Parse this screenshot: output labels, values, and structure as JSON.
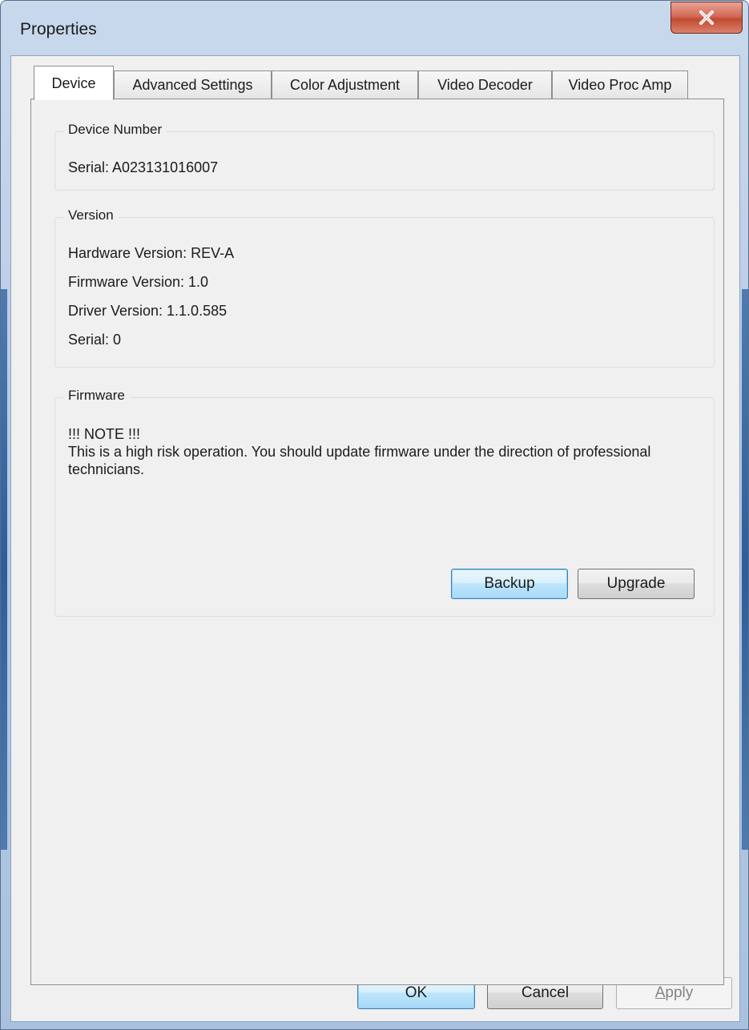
{
  "window": {
    "title": "Properties",
    "close_glyph": "X"
  },
  "tabs": [
    {
      "label": "Device",
      "active": true
    },
    {
      "label": "Advanced Settings",
      "active": false
    },
    {
      "label": "Color Adjustment",
      "active": false
    },
    {
      "label": "Video Decoder",
      "active": false
    },
    {
      "label": "Video Proc Amp",
      "active": false
    }
  ],
  "device_number": {
    "title": "Device Number",
    "serial": "Serial: A023131016007"
  },
  "version": {
    "title": "Version",
    "hardware": "Hardware Version: REV-A",
    "firmware": "Firmware Version: 1.0",
    "driver": "Driver Version: 1.1.0.585",
    "serial": "Serial: 0"
  },
  "firmware": {
    "title": "Firmware",
    "note_heading": "!!! NOTE !!!",
    "note_body": "This is a high risk operation. You should update firmware under the direction of professional technicians.",
    "backup_label": "Backup",
    "upgrade_label": "Upgrade"
  },
  "footer": {
    "ok_label": "OK",
    "cancel_label": "Cancel",
    "apply_accel": "A",
    "apply_rest": "pply"
  },
  "colors": {
    "close_red": "#c24a31",
    "focus_blue": "#3c7fb1",
    "dialog_bg": "#f0f0f0"
  }
}
